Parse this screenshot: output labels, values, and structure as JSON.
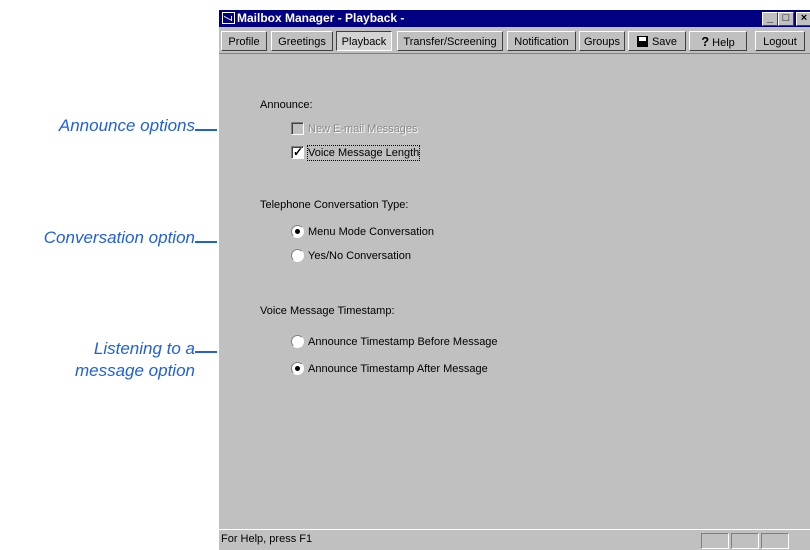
{
  "window": {
    "title": "Mailbox Manager - Playback -",
    "controls": {
      "minimize": "_",
      "maximize": "□",
      "close": "×"
    }
  },
  "toolbar": {
    "profile": "Profile",
    "greetings": "Greetings",
    "playback": "Playback",
    "transfer": "Transfer/Screening",
    "notification": "Notification",
    "groups": "Groups",
    "save": "Save",
    "help": "Help",
    "logout": "Logout"
  },
  "announce": {
    "heading": "Announce:",
    "new_email": {
      "label": "New E-mail Messages",
      "checked": false,
      "disabled": true
    },
    "voice_length": {
      "label": "Voice Message Length",
      "checked": true
    }
  },
  "conversation": {
    "heading": "Telephone Conversation Type:",
    "menu_mode": {
      "label": "Menu Mode Conversation",
      "selected": true
    },
    "yes_no": {
      "label": "Yes/No Conversation",
      "selected": false
    }
  },
  "timestamp": {
    "heading": "Voice Message Timestamp:",
    "before": {
      "label": "Announce Timestamp Before Message",
      "selected": false
    },
    "after": {
      "label": "Announce Timestamp After Message",
      "selected": true
    }
  },
  "status": {
    "text": "For Help, press F1"
  },
  "annotations": {
    "announce": "Announce options",
    "conversation": "Conversation option",
    "listening_line1": "Listening to a",
    "listening_line2": "message option"
  },
  "colors": {
    "annotation": "#1f5fe0",
    "titlebar": "#000080",
    "face": "#c0c0c0"
  }
}
